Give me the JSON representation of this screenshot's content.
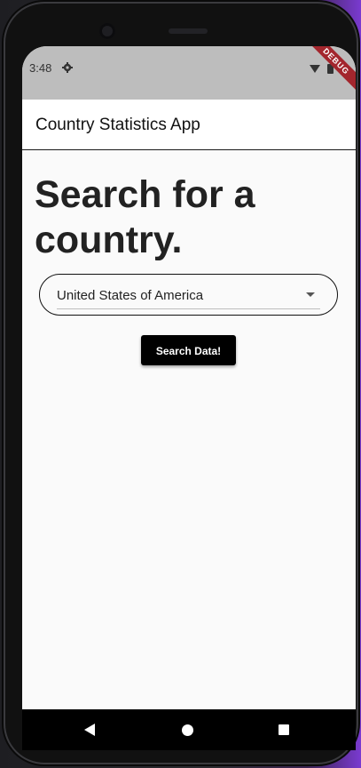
{
  "status_bar": {
    "time": "3:48",
    "icons": [
      "gear-icon",
      "wifi-icon",
      "battery-icon"
    ]
  },
  "debug_banner": "DEBUG",
  "app_bar": {
    "title": "Country Statistics App"
  },
  "main": {
    "heading": "Search for a country.",
    "country_dropdown": {
      "selected": "United States of America"
    },
    "search_button_label": "Search Data!"
  },
  "nav_bar": {
    "buttons": [
      "back-icon",
      "home-icon",
      "recents-icon"
    ]
  },
  "colors": {
    "status_bar_bg": "#bdbdbd",
    "app_bar_bg": "#ffffff",
    "page_bg": "#fafafa",
    "button_bg": "#000000",
    "debug_ribbon": "#a3262d"
  }
}
